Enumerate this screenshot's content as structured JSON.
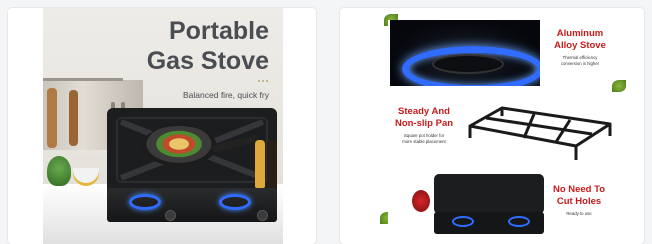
{
  "left_card": {
    "title_line1": "Portable",
    "title_line2": "Gas Stove",
    "subtitle": "Balanced fire, quick fry"
  },
  "right_card": {
    "feature1": {
      "title_line1": "Aluminum",
      "title_line2": "Alloy Stove",
      "desc_line1": "Thermal efficiency",
      "desc_line2": "conversion is higher"
    },
    "feature2": {
      "title_line1": "Steady And",
      "title_line2": "Non-slip Pan",
      "desc_line1": "Square pot holder for",
      "desc_line2": "more stable placement"
    },
    "feature3": {
      "title_line1": "No Need To",
      "title_line2": "Cut Holes",
      "desc_line1": "Ready to use"
    }
  },
  "colors": {
    "accent_red": "#c81a19",
    "flame_blue": "#2f6cff",
    "title_gray": "#4a4d51"
  }
}
